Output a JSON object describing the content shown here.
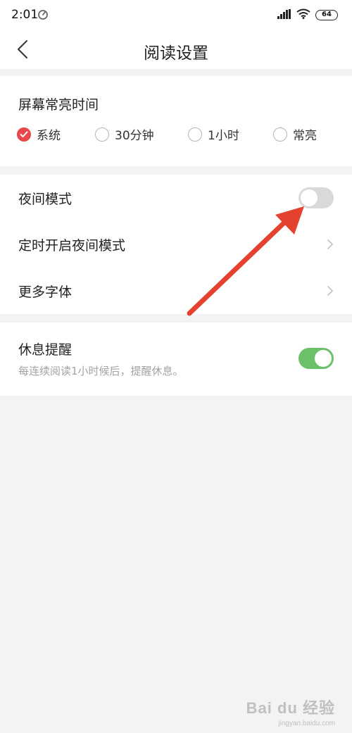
{
  "status_bar": {
    "time": "2:01",
    "sync_icon": "sync-icon",
    "signal_icon": "signal-icon",
    "wifi_icon": "wifi-icon",
    "battery": "64"
  },
  "header": {
    "title": "阅读设置",
    "back_icon": "chevron-left-icon"
  },
  "screen_timeout": {
    "label": "屏幕常亮时间",
    "options": [
      {
        "label": "系统",
        "selected": true
      },
      {
        "label": "30分钟",
        "selected": false
      },
      {
        "label": "1小时",
        "selected": false
      },
      {
        "label": "常亮",
        "selected": false
      }
    ]
  },
  "settings": {
    "night_mode": {
      "label": "夜间模式",
      "enabled": false
    },
    "scheduled_night": {
      "label": "定时开启夜间模式"
    },
    "more_fonts": {
      "label": "更多字体"
    }
  },
  "rest_reminder": {
    "label": "休息提醒",
    "description": "每连续阅读1小时候后，提醒休息。",
    "enabled": true
  },
  "annotation": {
    "arrow_color": "#e4412f"
  },
  "colors": {
    "accent_red": "#e8484b",
    "toggle_on": "#6bc06a",
    "toggle_off": "#d9d9d9",
    "background": "#f3f3f5"
  },
  "watermark": {
    "logo": "Bai du 经验",
    "url": "jingyan.baidu.com"
  }
}
